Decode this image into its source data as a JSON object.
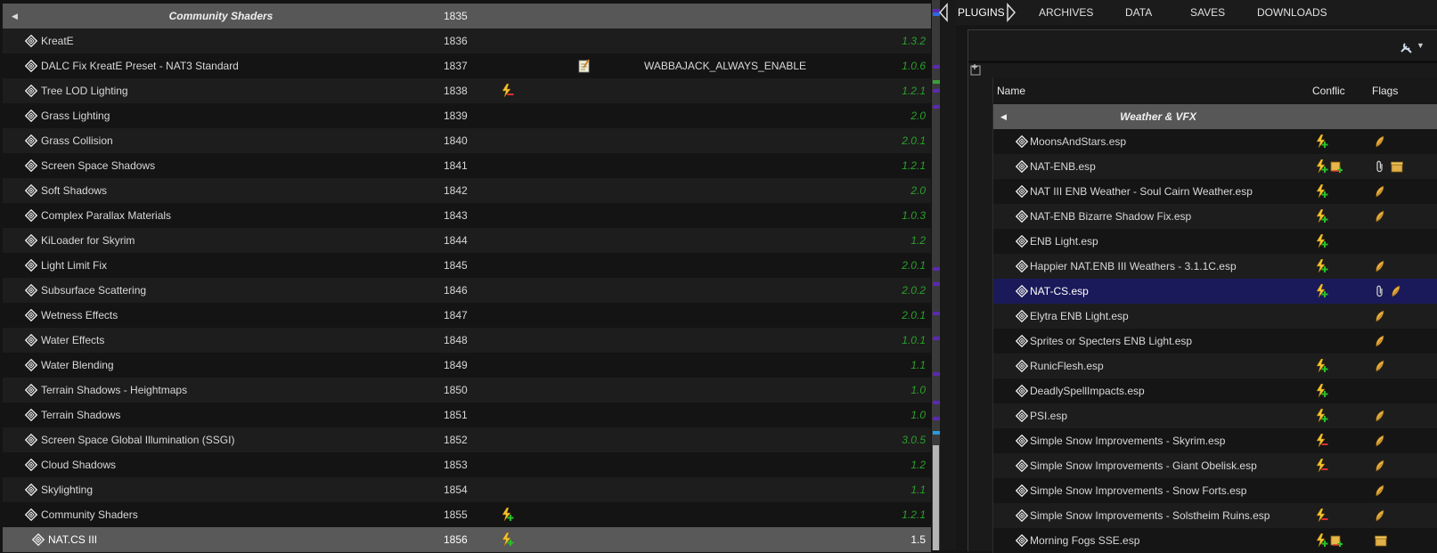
{
  "modlist": {
    "separator": {
      "name": "Community Shaders",
      "priority": "1835"
    },
    "rows": [
      {
        "name": "KreatE",
        "priority": "1836",
        "version": "1.3.2"
      },
      {
        "name": "DALC Fix KreatE Preset - NAT3 Standard",
        "priority": "1837",
        "version": "1.0.6",
        "notes": "WABBAJACK_ALWAYS_ENABLE",
        "has_notes_icon": true
      },
      {
        "name": "Tree LOD Lighting",
        "priority": "1838",
        "version": "1.2.1",
        "flag": "conflict-overwritten"
      },
      {
        "name": "Grass Lighting",
        "priority": "1839",
        "version": "2.0"
      },
      {
        "name": "Grass Collision",
        "priority": "1840",
        "version": "2.0.1"
      },
      {
        "name": "Screen Space Shadows",
        "priority": "1841",
        "version": "1.2.1"
      },
      {
        "name": "Soft Shadows",
        "priority": "1842",
        "version": "2.0"
      },
      {
        "name": "Complex Parallax Materials",
        "priority": "1843",
        "version": "1.0.3"
      },
      {
        "name": "KiLoader for Skyrim",
        "priority": "1844",
        "version": "1.2"
      },
      {
        "name": "Light Limit Fix",
        "priority": "1845",
        "version": "2.0.1"
      },
      {
        "name": "Subsurface Scattering",
        "priority": "1846",
        "version": "2.0.2"
      },
      {
        "name": "Wetness Effects",
        "priority": "1847",
        "version": "2.0.1"
      },
      {
        "name": "Water Effects",
        "priority": "1848",
        "version": "1.0.1"
      },
      {
        "name": "Water Blending",
        "priority": "1849",
        "version": "1.1"
      },
      {
        "name": "Terrain Shadows - Heightmaps",
        "priority": "1850",
        "version": "1.0"
      },
      {
        "name": "Terrain Shadows",
        "priority": "1851",
        "version": "1.0"
      },
      {
        "name": "Screen Space Global Illumination (SSGI)",
        "priority": "1852",
        "version": "3.0.5"
      },
      {
        "name": "Cloud Shadows",
        "priority": "1853",
        "version": "1.2"
      },
      {
        "name": "Skylighting",
        "priority": "1854",
        "version": "1.1"
      },
      {
        "name": "Community Shaders",
        "priority": "1855",
        "version": "1.2.1",
        "flag": "conflict-overwrites"
      },
      {
        "name": "NAT.CS III",
        "priority": "1856",
        "version": "1.5",
        "flag": "conflict-overwrites",
        "selected": true
      }
    ]
  },
  "tabs": {
    "plugins": "PLUGINS",
    "archives": "ARCHIVES",
    "data": "DATA",
    "saves": "SAVES",
    "downloads": "DOWNLOADS"
  },
  "plugins": {
    "headers": {
      "name": "Name",
      "conflicts": "Conflic",
      "flags": "Flags"
    },
    "separator": "Weather & VFX",
    "rows": [
      {
        "name": "MoonsAndStars.esp",
        "c": [
          "overwrites"
        ],
        "f": [
          "light"
        ]
      },
      {
        "name": "NAT-ENB.esp",
        "c": [
          "overwrites",
          "both"
        ],
        "f": [
          "clip",
          "archive"
        ]
      },
      {
        "name": "NAT III ENB Weather - Soul Cairn Weather.esp",
        "c": [
          "overwrites"
        ],
        "f": [
          "light"
        ]
      },
      {
        "name": "NAT-ENB Bizarre Shadow Fix.esp",
        "c": [
          "overwrites"
        ],
        "f": [
          "light"
        ]
      },
      {
        "name": "ENB Light.esp",
        "c": [
          "overwrites"
        ],
        "f": []
      },
      {
        "name": "Happier NAT.ENB III Weathers - 3.1.1C.esp",
        "c": [
          "overwrites"
        ],
        "f": [
          "light"
        ]
      },
      {
        "name": "NAT-CS.esp",
        "c": [
          "overwrites"
        ],
        "f": [
          "clip",
          "light"
        ],
        "selected": true
      },
      {
        "name": "Elytra ENB Light.esp",
        "c": [],
        "f": [
          "light"
        ]
      },
      {
        "name": "Sprites or Specters ENB Light.esp",
        "c": [],
        "f": [
          "light"
        ]
      },
      {
        "name": "RunicFlesh.esp",
        "c": [
          "overwrites"
        ],
        "f": [
          "light"
        ]
      },
      {
        "name": "DeadlySpellImpacts.esp",
        "c": [
          "overwrites"
        ],
        "f": []
      },
      {
        "name": "PSI.esp",
        "c": [
          "overwrites"
        ],
        "f": [
          "light"
        ]
      },
      {
        "name": "Simple Snow Improvements - Skyrim.esp",
        "c": [
          "overwritten"
        ],
        "f": [
          "light"
        ]
      },
      {
        "name": "Simple Snow Improvements - Giant Obelisk.esp",
        "c": [
          "overwritten"
        ],
        "f": [
          "light"
        ]
      },
      {
        "name": "Simple Snow Improvements - Snow Forts.esp",
        "c": [],
        "f": [
          "light"
        ]
      },
      {
        "name": "Simple Snow Improvements - Solstheim Ruins.esp",
        "c": [
          "overwritten"
        ],
        "f": [
          "light"
        ]
      },
      {
        "name": "Morning Fogs SSE.esp",
        "c": [
          "overwrites",
          "both"
        ],
        "f": [
          "archive"
        ]
      }
    ]
  },
  "colors": {
    "version_green": "#2aa02a",
    "separator_gray": "#575757",
    "selection_blue": "#1a1a5a"
  },
  "icons": {
    "checkbox": "puzzle-checkbox-icon",
    "conflict_overwrites": "lightning-plus-icon",
    "conflict_overwritten": "lightning-minus-icon",
    "notes": "notepad-icon",
    "light_flag": "feather-icon",
    "clip_flag": "paperclip-icon",
    "archive_flag": "archive-box-icon",
    "tools": "tools-icon"
  }
}
